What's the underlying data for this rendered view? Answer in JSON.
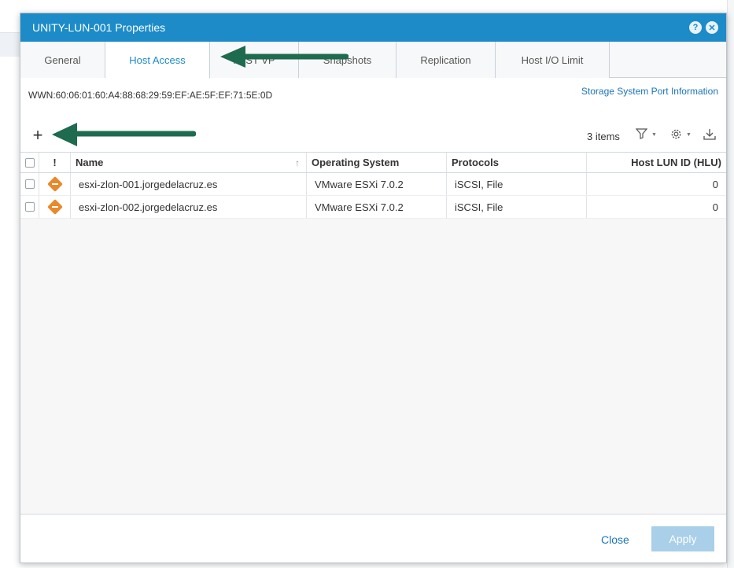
{
  "dialog": {
    "title": "UNITY-LUN-001 Properties",
    "help_icon": "?",
    "close_icon": "✕"
  },
  "tabs": [
    {
      "label": "General"
    },
    {
      "label": "Host Access",
      "active": true
    },
    {
      "label": "FAST VP"
    },
    {
      "label": "Snapshots"
    },
    {
      "label": "Replication"
    },
    {
      "label": "Host I/O Limit"
    }
  ],
  "wwn": "WWN:60:06:01:60:A4:88:68:29:59:EF:AE:5F:EF:71:5E:0D",
  "port_info_link": "Storage System Port Information",
  "toolbar": {
    "add_icon": "+",
    "items_count": "3 items"
  },
  "table": {
    "headers": {
      "warning": "!",
      "name": "Name",
      "os": "Operating System",
      "protocols": "Protocols",
      "hlu": "Host LUN ID (HLU)"
    },
    "rows": [
      {
        "name": "esxi-zlon-001.jorgedelacruz.es",
        "os": "VMware ESXi 7.0.2",
        "protocols": "iSCSI, File",
        "hlu": "0"
      },
      {
        "name": "esxi-zlon-002.jorgedelacruz.es",
        "os": "VMware ESXi 7.0.2",
        "protocols": "iSCSI, File",
        "hlu": "0"
      }
    ]
  },
  "footer": {
    "close_label": "Close",
    "apply_label": "Apply"
  },
  "colors": {
    "titlebar": "#1c8bc8",
    "accent": "#1a75b8",
    "warning": "#e8892b",
    "annotation_arrow": "#1e6b4f"
  }
}
